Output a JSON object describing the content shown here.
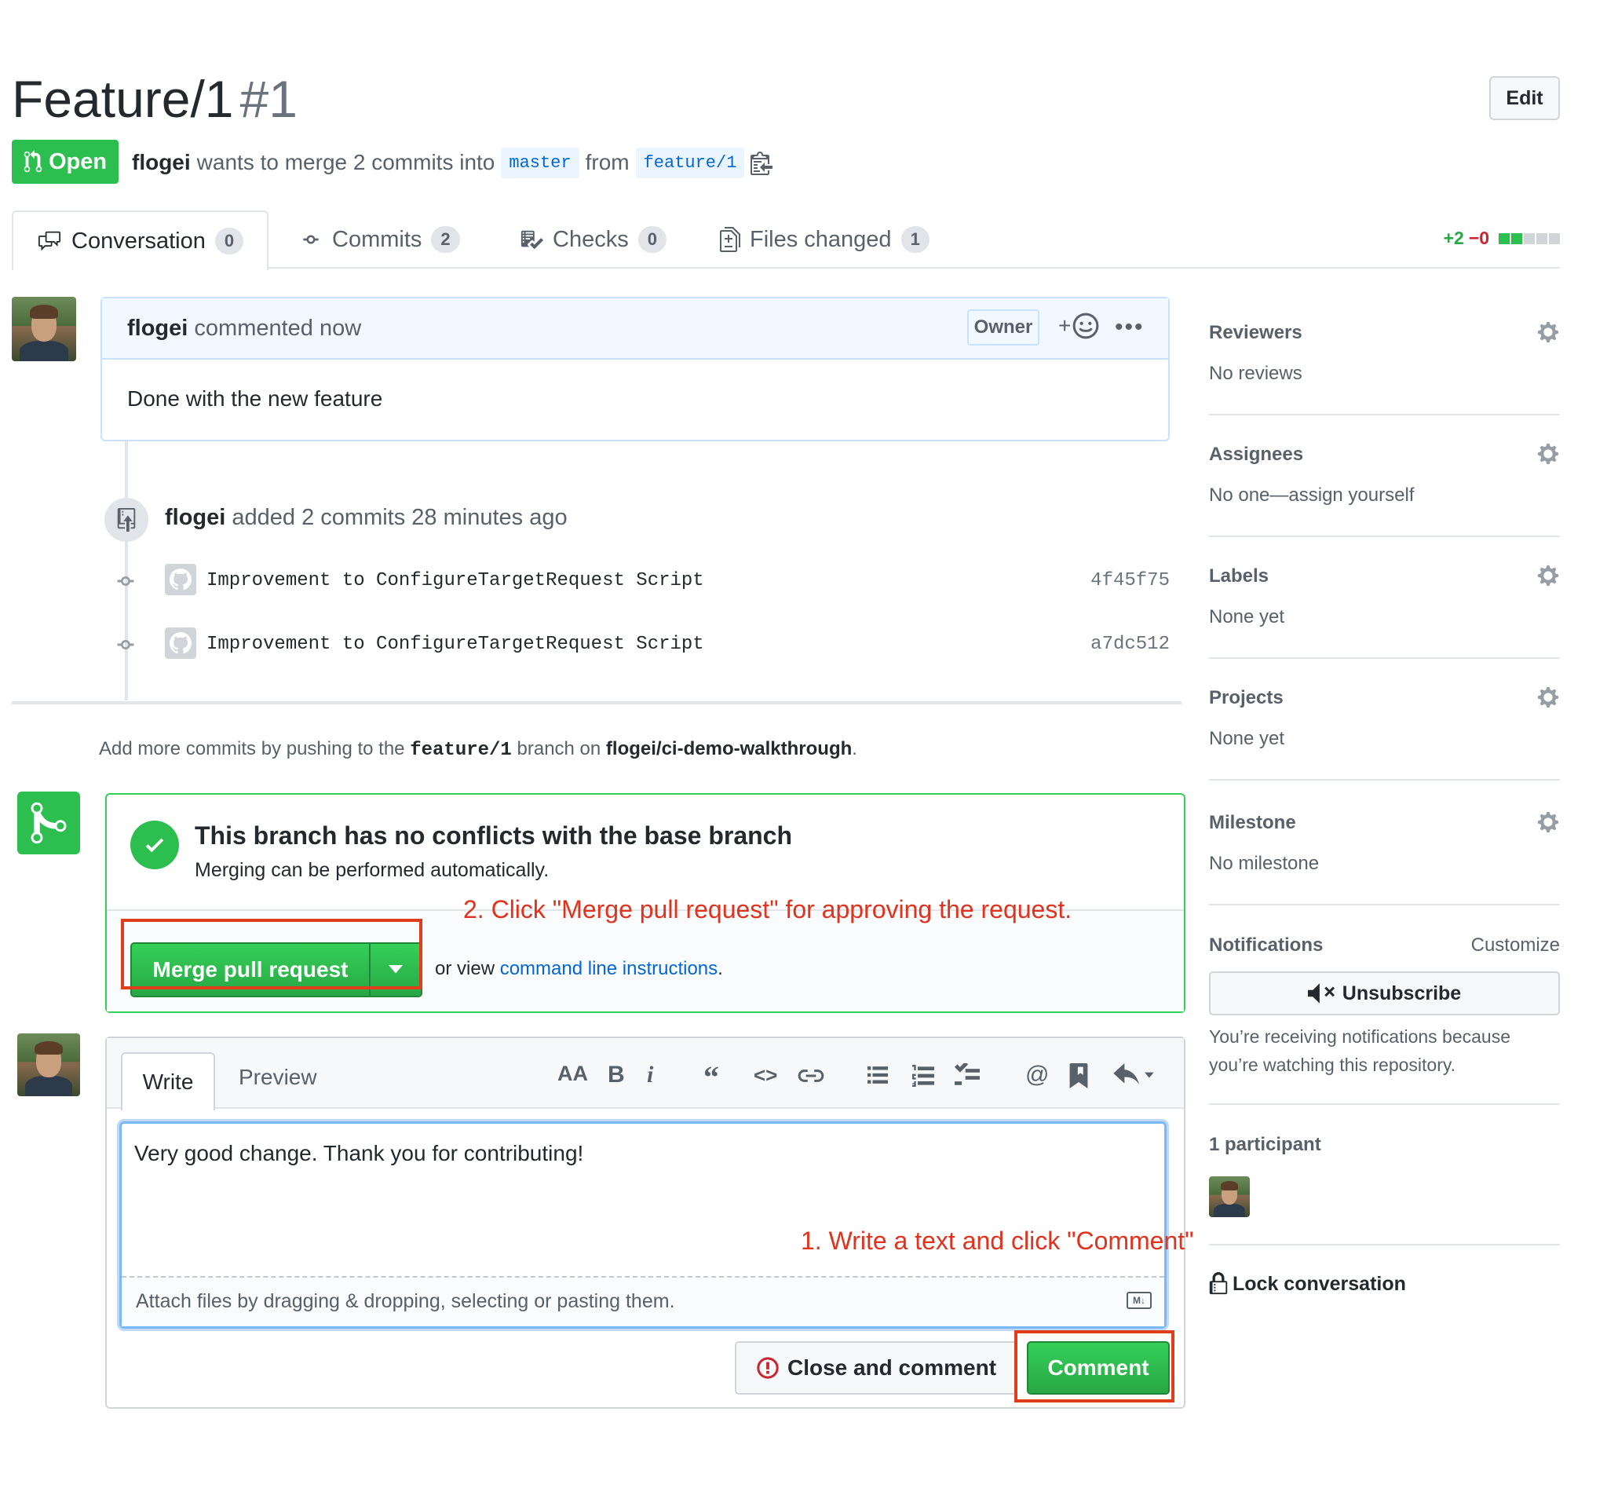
{
  "header": {
    "title": "Feature/1",
    "number": "#1",
    "edit_label": "Edit",
    "state": "Open",
    "author": "flogei",
    "merge_text": "wants to merge 2 commits into",
    "base_branch": "master",
    "from_text": "from",
    "head_branch": "feature/1"
  },
  "tabs": [
    {
      "label": "Conversation",
      "count": "0"
    },
    {
      "label": "Commits",
      "count": "2"
    },
    {
      "label": "Checks",
      "count": "0"
    },
    {
      "label": "Files changed",
      "count": "1"
    }
  ],
  "diffstat": {
    "additions": "+2",
    "deletions": "−0"
  },
  "comment": {
    "author": "flogei",
    "action": "commented now",
    "role": "Owner",
    "body": "Done with the new feature"
  },
  "timeline": {
    "push_author": "flogei",
    "push_text": "added 2 commits 28 minutes ago",
    "commits": [
      {
        "message": "Improvement to ConfigureTargetRequest Script",
        "sha": "4f45f75"
      },
      {
        "message": "Improvement to ConfigureTargetRequest Script",
        "sha": "a7dc512"
      }
    ],
    "hint_prefix": "Add more commits by pushing to the",
    "hint_branch": "feature/1",
    "hint_mid": "branch on",
    "hint_repo": "flogei/ci-demo-walkthrough",
    "hint_end": "."
  },
  "merge": {
    "title": "This branch has no conflicts with the base branch",
    "subtitle": "Merging can be performed automatically.",
    "button": "Merge pull request",
    "or_view": "or view",
    "cli_link": "command line instructions",
    "cli_end": "."
  },
  "annotations": {
    "step2": "2. Click \"Merge pull request\" for approving the request.",
    "step1": "1. Write a text and click \"Comment\""
  },
  "new_comment": {
    "tab_write": "Write",
    "tab_preview": "Preview",
    "text": "Very good change. Thank you for contributing!",
    "attach": "Attach files by dragging & dropping, selecting or pasting them.",
    "close_button": "Close and comment",
    "comment_button": "Comment"
  },
  "sidebar": {
    "reviewers": {
      "title": "Reviewers",
      "value": "No reviews"
    },
    "assignees": {
      "title": "Assignees",
      "value": "No one—assign yourself"
    },
    "labels": {
      "title": "Labels",
      "value": "None yet"
    },
    "projects": {
      "title": "Projects",
      "value": "None yet"
    },
    "milestone": {
      "title": "Milestone",
      "value": "No milestone"
    },
    "notifications": {
      "title": "Notifications",
      "customize": "Customize",
      "button": "Unsubscribe",
      "reason": "You’re receiving notifications because you’re watching this repository."
    },
    "participants": {
      "title": "1 participant"
    },
    "lock": "Lock conversation"
  },
  "colors": {
    "accent_green": "#2cbe4e",
    "link_blue": "#0366d6",
    "annotation_red": "#e0321c"
  }
}
